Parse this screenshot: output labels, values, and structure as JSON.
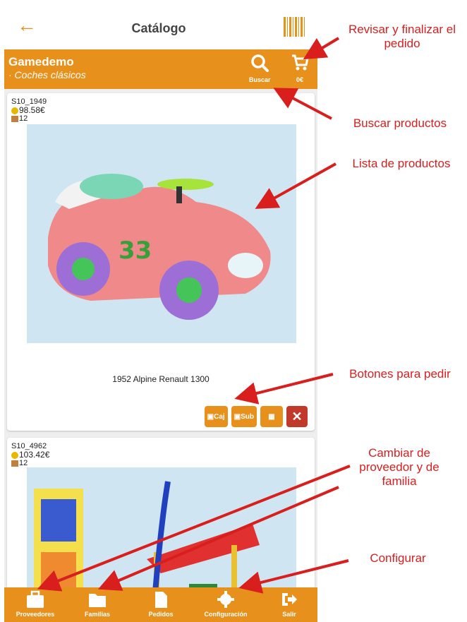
{
  "header": {
    "back_icon": "arrow-left-icon",
    "title": "Catálogo",
    "barcode_icon": "barcode-icon"
  },
  "store_bar": {
    "shop_name": "Gamedemo",
    "family": "· Coches clásicos",
    "search_label": "Buscar",
    "cart_total": "0€"
  },
  "products": [
    {
      "code": "S10_1949",
      "price": "98.58€",
      "stock": "12",
      "name": "1952 Alpine Renault 1300",
      "buttons": [
        "Caj",
        "Sub",
        "",
        "✕"
      ]
    },
    {
      "code": "S10_4962",
      "price": "103.42€",
      "stock": "12",
      "name": ""
    }
  ],
  "bottom_nav": [
    {
      "label": "Proveedores",
      "icon": "briefcase-icon"
    },
    {
      "label": "Familias",
      "icon": "folder-icon"
    },
    {
      "label": "Pedidos",
      "icon": "document-icon"
    },
    {
      "label": "Configuración",
      "icon": "gear-icon"
    },
    {
      "label": "Salir",
      "icon": "logout-icon"
    }
  ],
  "annotations": {
    "revisar": "Revisar y finalizar el pedido",
    "buscar": "Buscar productos",
    "lista": "Lista de productos",
    "botones": "Botones para pedir",
    "cambiar": "Cambiar de proveedor y de familia",
    "configurar": "Configurar"
  },
  "colors": {
    "accent": "#e8901c",
    "annotation": "#d91e1e",
    "delete": "#c0392b"
  }
}
